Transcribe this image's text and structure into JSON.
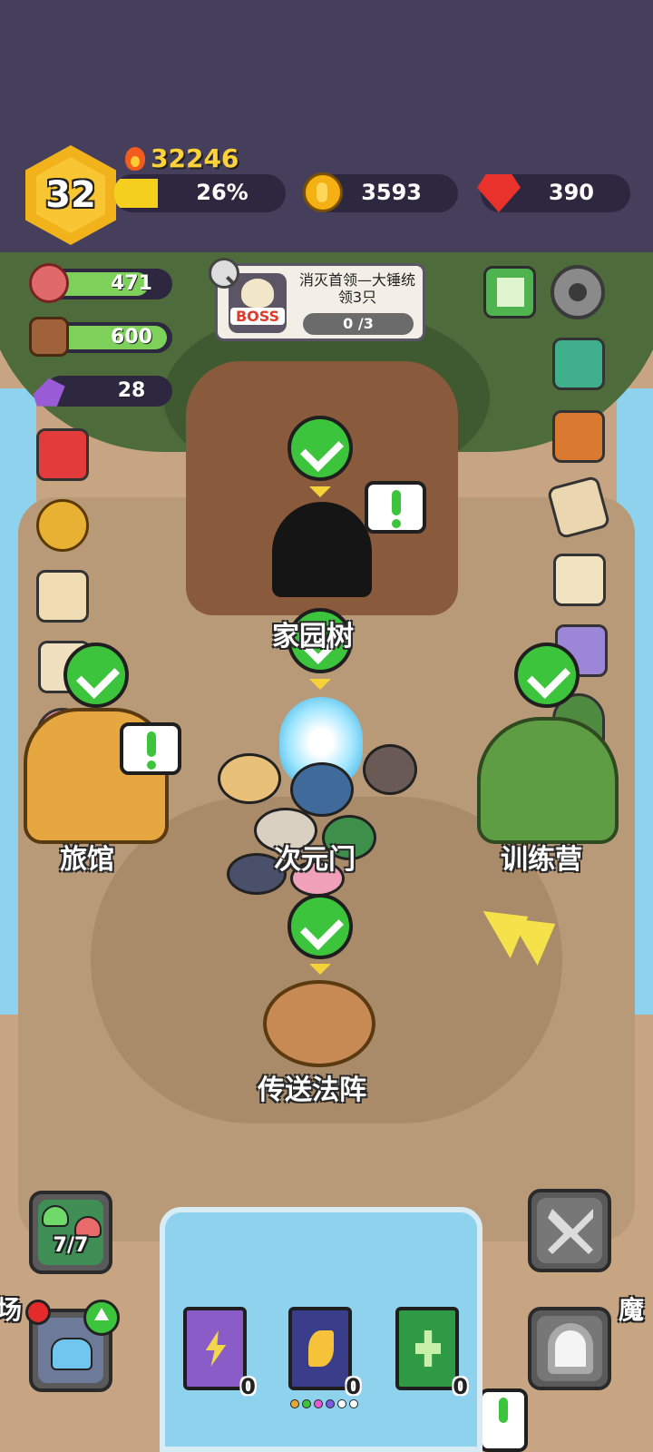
{
  "player": {
    "level": "32",
    "power": "32246",
    "xp_percent_label": "26%",
    "xp_fraction": 0.26
  },
  "currencies": {
    "gold": "3593",
    "gems": "390"
  },
  "resources": [
    {
      "name": "meat",
      "value": "471",
      "fill": 0.85,
      "icon": "meat-icon"
    },
    {
      "name": "wood",
      "value": "600",
      "fill": 1.0,
      "icon": "wood-icon"
    },
    {
      "name": "ore",
      "value": "28",
      "fill": 0.0,
      "icon": "ore-icon"
    }
  ],
  "boss_quest": {
    "badge": "BOSS",
    "title": "消灭首领—大锤统领3只",
    "progress": "0 /3"
  },
  "map_labels": {
    "inn": "旅馆",
    "portal": "次元门",
    "training": "训练营",
    "teleport": "传送法阵",
    "tree": "家园树",
    "left_cut": "场",
    "right_cut": "魔"
  },
  "slime_button": {
    "count": "7/7"
  },
  "books": [
    {
      "name": "lightning-book",
      "count": "0",
      "color": "#8a5cc8"
    },
    {
      "name": "wing-book",
      "count": "0",
      "color": "#3a3d8a"
    },
    {
      "name": "heal-book",
      "count": "0",
      "color": "#2f9a45"
    }
  ],
  "colors": {
    "accent_gold": "#f5cf1e",
    "check_green": "#3cc43c",
    "hud_bg": "#2d2840",
    "sky": "#463f5c"
  }
}
